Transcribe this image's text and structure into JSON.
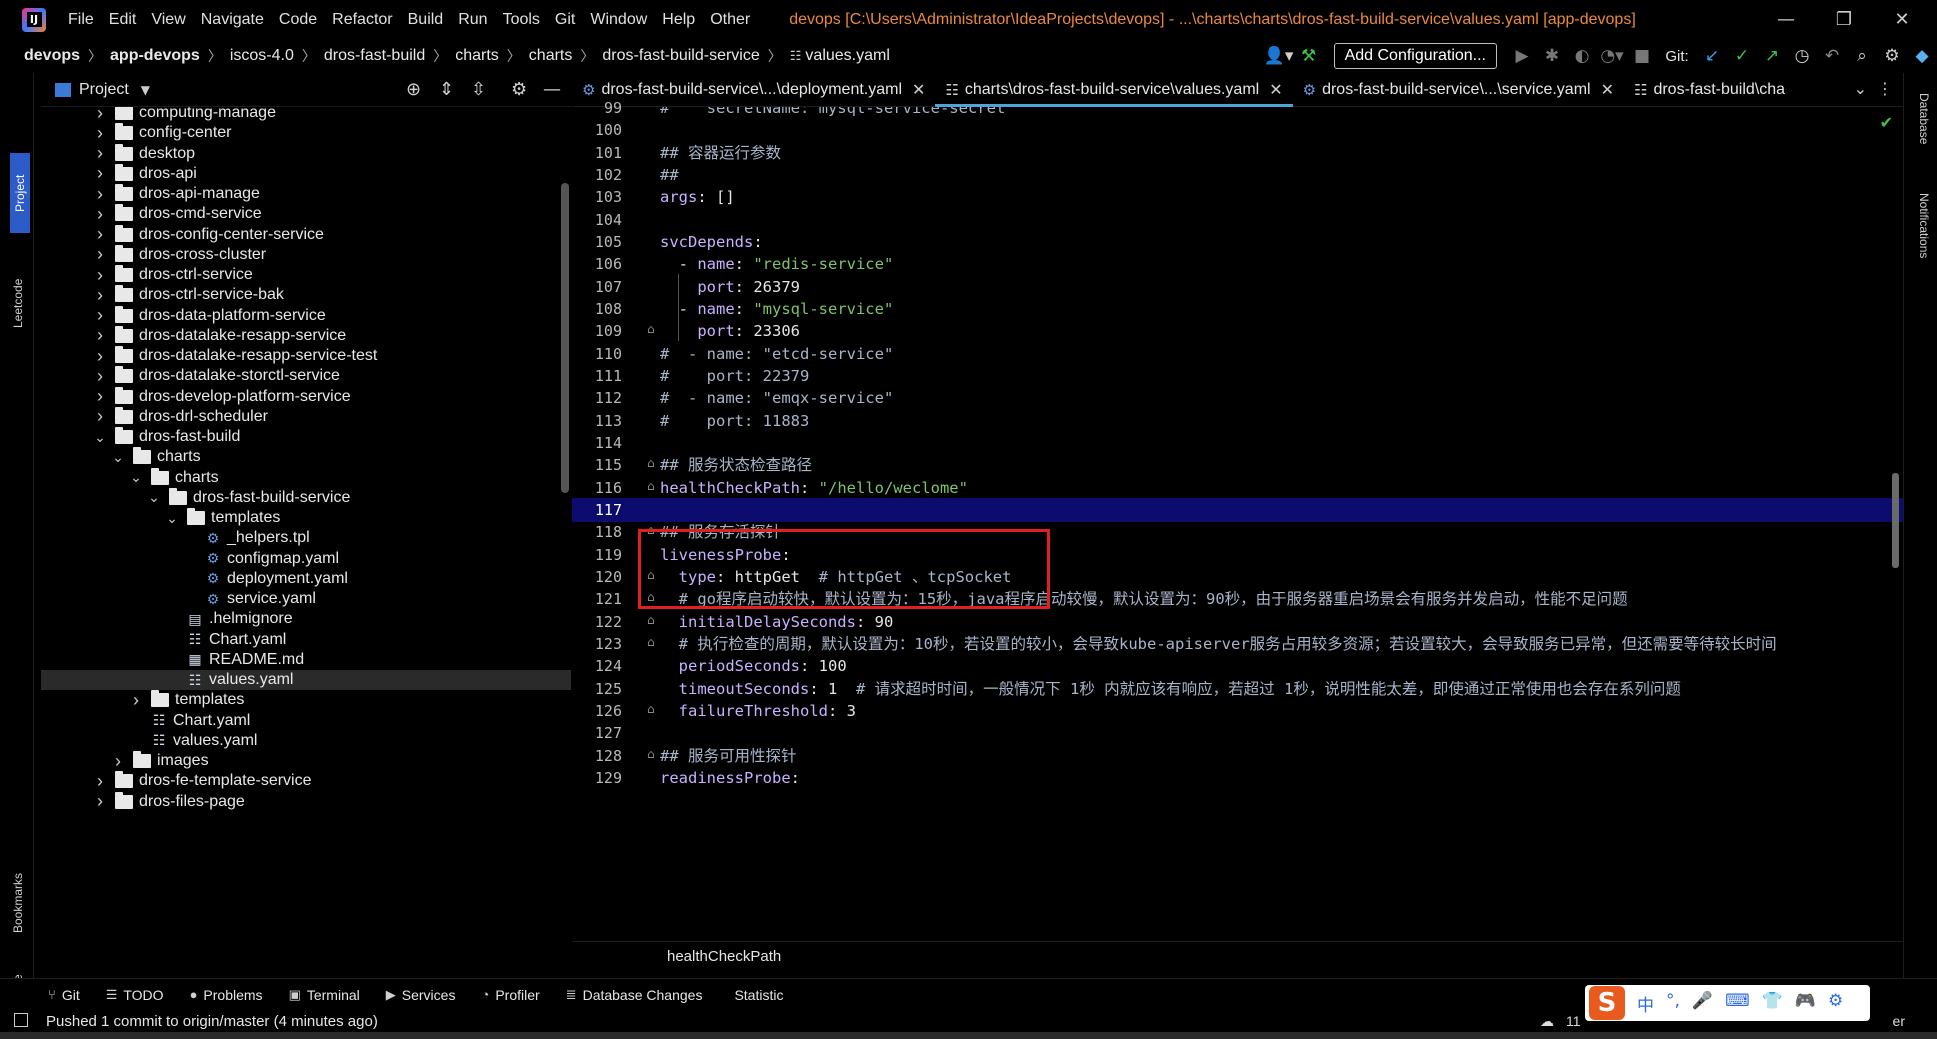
{
  "window": {
    "title": "devops [C:\\Users\\Administrator\\IdeaProjects\\devops] - ...\\charts\\charts\\dros-fast-build-service\\values.yaml [app-devops]",
    "menu": [
      "File",
      "Edit",
      "View",
      "Navigate",
      "Code",
      "Refactor",
      "Build",
      "Run",
      "Tools",
      "Git",
      "Window",
      "Help",
      "Other"
    ]
  },
  "breadcrumb": [
    "devops",
    "app-devops",
    "iscos-4.0",
    "dros-fast-build",
    "charts",
    "charts",
    "dros-fast-build-service",
    "values.yaml"
  ],
  "toolbar": {
    "add_config": "Add Configuration...",
    "git_label": "Git:"
  },
  "left_tabs": {
    "project": "Project",
    "leetcode": "Leetcode",
    "bookmarks": "Bookmarks",
    "structure": "Structure"
  },
  "right_tabs": {
    "database": "Database",
    "notifications": "Notifications"
  },
  "project_panel": {
    "title": "Project",
    "tree": [
      {
        "label": "computing-manage",
        "depth": 0,
        "type": "folder",
        "expanded": false
      },
      {
        "label": "config-center",
        "depth": 0,
        "type": "folder",
        "expanded": false
      },
      {
        "label": "desktop",
        "depth": 0,
        "type": "folder",
        "expanded": false
      },
      {
        "label": "dros-api",
        "depth": 0,
        "type": "folder",
        "expanded": false
      },
      {
        "label": "dros-api-manage",
        "depth": 0,
        "type": "folder",
        "expanded": false
      },
      {
        "label": "dros-cmd-service",
        "depth": 0,
        "type": "folder",
        "expanded": false
      },
      {
        "label": "dros-config-center-service",
        "depth": 0,
        "type": "folder",
        "expanded": false
      },
      {
        "label": "dros-cross-cluster",
        "depth": 0,
        "type": "folder",
        "expanded": false
      },
      {
        "label": "dros-ctrl-service",
        "depth": 0,
        "type": "folder",
        "expanded": false
      },
      {
        "label": "dros-ctrl-service-bak",
        "depth": 0,
        "type": "folder",
        "expanded": false
      },
      {
        "label": "dros-data-platform-service",
        "depth": 0,
        "type": "folder",
        "expanded": false
      },
      {
        "label": "dros-datalake-resapp-service",
        "depth": 0,
        "type": "folder",
        "expanded": false
      },
      {
        "label": "dros-datalake-resapp-service-test",
        "depth": 0,
        "type": "folder",
        "expanded": false
      },
      {
        "label": "dros-datalake-storctl-service",
        "depth": 0,
        "type": "folder",
        "expanded": false
      },
      {
        "label": "dros-develop-platform-service",
        "depth": 0,
        "type": "folder",
        "expanded": false
      },
      {
        "label": "dros-drl-scheduler",
        "depth": 0,
        "type": "folder",
        "expanded": false
      },
      {
        "label": "dros-fast-build",
        "depth": 0,
        "type": "folder",
        "expanded": true
      },
      {
        "label": "charts",
        "depth": 1,
        "type": "folder",
        "expanded": true
      },
      {
        "label": "charts",
        "depth": 2,
        "type": "folder",
        "expanded": true
      },
      {
        "label": "dros-fast-build-service",
        "depth": 3,
        "type": "folder",
        "expanded": true
      },
      {
        "label": "templates",
        "depth": 4,
        "type": "folder",
        "expanded": true
      },
      {
        "label": "_helpers.tpl",
        "depth": 5,
        "type": "file",
        "icon": "gear"
      },
      {
        "label": "configmap.yaml",
        "depth": 5,
        "type": "file",
        "icon": "gear"
      },
      {
        "label": "deployment.yaml",
        "depth": 5,
        "type": "file",
        "icon": "gear"
      },
      {
        "label": "service.yaml",
        "depth": 5,
        "type": "file",
        "icon": "gear"
      },
      {
        "label": ".helmignore",
        "depth": 4,
        "type": "file",
        "icon": "doc"
      },
      {
        "label": "Chart.yaml",
        "depth": 4,
        "type": "file",
        "icon": "yaml"
      },
      {
        "label": "README.md",
        "depth": 4,
        "type": "file",
        "icon": "md"
      },
      {
        "label": "values.yaml",
        "depth": 4,
        "type": "file",
        "icon": "yaml",
        "selected": true
      },
      {
        "label": "templates",
        "depth": 2,
        "type": "folder",
        "expanded": false
      },
      {
        "label": "Chart.yaml",
        "depth": 2,
        "type": "file",
        "icon": "yaml"
      },
      {
        "label": "values.yaml",
        "depth": 2,
        "type": "file",
        "icon": "yaml"
      },
      {
        "label": "images",
        "depth": 1,
        "type": "folder",
        "expanded": false
      },
      {
        "label": "dros-fe-template-service",
        "depth": 0,
        "type": "folder",
        "expanded": false
      },
      {
        "label": "dros-files-page",
        "depth": 0,
        "type": "folder",
        "expanded": false
      }
    ]
  },
  "editor": {
    "tabs": [
      {
        "label": "dros-fast-build-service\\...\\deployment.yaml",
        "active": false
      },
      {
        "label": "charts\\dros-fast-build-service\\values.yaml",
        "active": true
      },
      {
        "label": "dros-fast-build-service\\...\\service.yaml",
        "active": false
      },
      {
        "label": "dros-fast-build\\cha",
        "active": false
      }
    ],
    "current_line": 117,
    "lines": [
      {
        "n": 99,
        "parts": [
          [
            "c",
            "#    secretName: mysql-service-secret"
          ]
        ]
      },
      {
        "n": 100,
        "parts": []
      },
      {
        "n": 101,
        "parts": [
          [
            "c",
            "## 容器运行参数"
          ]
        ]
      },
      {
        "n": 102,
        "parts": [
          [
            "c",
            "##"
          ]
        ]
      },
      {
        "n": 103,
        "parts": [
          [
            "k",
            "args"
          ],
          [
            "p",
            ": []"
          ]
        ]
      },
      {
        "n": 104,
        "parts": []
      },
      {
        "n": 105,
        "parts": [
          [
            "k",
            "svcDepends"
          ],
          [
            "p",
            ":"
          ]
        ]
      },
      {
        "n": 106,
        "parts": [
          [
            "p",
            "  - "
          ],
          [
            "k",
            "name"
          ],
          [
            "p",
            ": "
          ],
          [
            "s",
            "\"redis-service\""
          ]
        ]
      },
      {
        "n": 107,
        "parts": [
          [
            "p",
            "    "
          ],
          [
            "k",
            "port"
          ],
          [
            "p",
            ": 26379"
          ]
        ]
      },
      {
        "n": 108,
        "parts": [
          [
            "p",
            "  - "
          ],
          [
            "k",
            "name"
          ],
          [
            "p",
            ": "
          ],
          [
            "s",
            "\"mysql-service\""
          ]
        ]
      },
      {
        "n": 109,
        "parts": [
          [
            "p",
            "    "
          ],
          [
            "k",
            "port"
          ],
          [
            "p",
            ": 23306"
          ]
        ]
      },
      {
        "n": 110,
        "parts": [
          [
            "c",
            "#  - name: \"etcd-service\""
          ]
        ]
      },
      {
        "n": 111,
        "parts": [
          [
            "c",
            "#    port: 22379"
          ]
        ]
      },
      {
        "n": 112,
        "parts": [
          [
            "c",
            "#  - name: \"emqx-service\""
          ]
        ]
      },
      {
        "n": 113,
        "parts": [
          [
            "c",
            "#    port: 11883"
          ]
        ]
      },
      {
        "n": 114,
        "parts": []
      },
      {
        "n": 115,
        "parts": [
          [
            "c",
            "## 服务状态检查路径"
          ]
        ]
      },
      {
        "n": 116,
        "parts": [
          [
            "k",
            "healthCheckPath"
          ],
          [
            "p",
            ": "
          ],
          [
            "s",
            "\"/hello/weclome\""
          ]
        ]
      },
      {
        "n": 117,
        "parts": []
      },
      {
        "n": 118,
        "parts": [
          [
            "c",
            "## 服务存活探针"
          ]
        ]
      },
      {
        "n": 119,
        "parts": [
          [
            "k",
            "livenessProbe"
          ],
          [
            "p",
            ":"
          ]
        ]
      },
      {
        "n": 120,
        "parts": [
          [
            "p",
            "  "
          ],
          [
            "k",
            "type"
          ],
          [
            "p",
            ": httpGet  "
          ],
          [
            "c",
            "# httpGet 、tcpSocket"
          ]
        ]
      },
      {
        "n": 121,
        "parts": [
          [
            "p",
            "  "
          ],
          [
            "c",
            "# go程序启动较快，默认设置为：15秒，java程序启动较慢，默认设置为：90秒，由于服务器重启场景会有服务并发启动，性能不足问题"
          ]
        ]
      },
      {
        "n": 122,
        "parts": [
          [
            "p",
            "  "
          ],
          [
            "k",
            "initialDelaySeconds"
          ],
          [
            "p",
            ": 90"
          ]
        ]
      },
      {
        "n": 123,
        "parts": [
          [
            "p",
            "  "
          ],
          [
            "c",
            "# 执行检查的周期，默认设置为：10秒，若设置的较小，会导致kube-apiserver服务占用较多资源；若设置较大，会导致服务已异常，但还需要等待较长时间"
          ]
        ]
      },
      {
        "n": 124,
        "parts": [
          [
            "p",
            "  "
          ],
          [
            "k",
            "periodSeconds"
          ],
          [
            "p",
            ": 100"
          ]
        ]
      },
      {
        "n": 125,
        "parts": [
          [
            "p",
            "  "
          ],
          [
            "k",
            "timeoutSeconds"
          ],
          [
            "p",
            ": 1  "
          ],
          [
            "c",
            "# 请求超时时间，一般情况下 1秒 内就应该有响应，若超过 1秒，说明性能太差，即使通过正常使用也会存在系列问题"
          ]
        ]
      },
      {
        "n": 126,
        "parts": [
          [
            "p",
            "  "
          ],
          [
            "k",
            "failureThreshold"
          ],
          [
            "p",
            ": 3"
          ]
        ]
      },
      {
        "n": 127,
        "parts": []
      },
      {
        "n": 128,
        "parts": [
          [
            "c",
            "## 服务可用性探针"
          ]
        ]
      },
      {
        "n": 129,
        "parts": [
          [
            "k",
            "readinessProbe"
          ],
          [
            "p",
            ":"
          ]
        ]
      }
    ],
    "breadcrumb_bottom": "healthCheckPath"
  },
  "bottom_tools": [
    {
      "icon": "git-icon",
      "glyph": "⑂",
      "label": "Git"
    },
    {
      "icon": "todo-icon",
      "glyph": "☰",
      "label": "TODO"
    },
    {
      "icon": "problems-icon",
      "glyph": "●",
      "label": "Problems"
    },
    {
      "icon": "terminal-icon",
      "glyph": "▣",
      "label": "Terminal"
    },
    {
      "icon": "services-icon",
      "glyph": "▶",
      "label": "Services"
    },
    {
      "icon": "profiler-icon",
      "glyph": "◔",
      "label": "Profiler"
    },
    {
      "icon": "database-changes-icon",
      "glyph": "≣",
      "label": "Database Changes"
    },
    {
      "icon": "statistic-icon",
      "glyph": "",
      "label": "Statistic"
    }
  ],
  "status": {
    "message": "Pushed 1 commit to origin/master (4 minutes ago)",
    "right_text": "11",
    "right_tail": "er"
  },
  "ime": {
    "chars": [
      "中",
      "°,",
      "🎤",
      "⌨",
      "👕",
      "🎮",
      "⚙"
    ]
  }
}
